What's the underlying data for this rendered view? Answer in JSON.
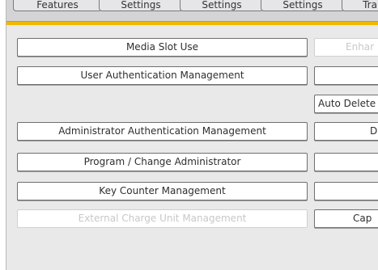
{
  "tabs": [
    "Features",
    "Settings",
    "Settings",
    "Settings",
    "Tra"
  ],
  "left_buttons": [
    {
      "label": "Media Slot Use",
      "disabled": false
    },
    {
      "label": "User Authentication Management",
      "disabled": false
    },
    {
      "label": "Administrator Authentication Management",
      "disabled": false
    },
    {
      "label": "Program / Change Administrator",
      "disabled": false
    },
    {
      "label": "Key Counter Management",
      "disabled": false
    },
    {
      "label": "External Charge Unit Management",
      "disabled": true
    }
  ],
  "right_buttons": [
    {
      "label": "Enhar",
      "disabled": true
    },
    {
      "label": "",
      "disabled": false
    },
    {
      "label": "Auto Delete",
      "disabled": false
    },
    {
      "label": "De",
      "disabled": false
    },
    {
      "label": "",
      "disabled": false
    },
    {
      "label": "",
      "disabled": false
    },
    {
      "label": "Cap",
      "disabled": false
    }
  ]
}
